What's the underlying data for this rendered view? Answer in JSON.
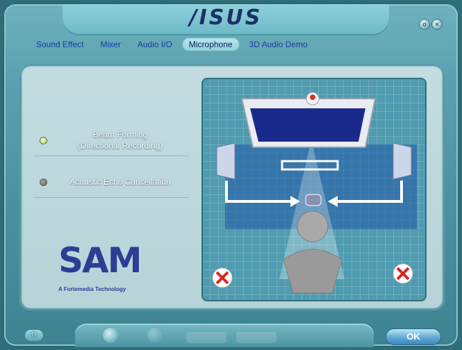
{
  "header": {
    "logo_text": "/ISUS",
    "minimize_glyph": "o",
    "close_glyph": "×"
  },
  "tabs": [
    {
      "label": "Sound Effect"
    },
    {
      "label": "Mixer"
    },
    {
      "label": "Audio I/O"
    },
    {
      "label": "Microphone",
      "active": true
    },
    {
      "label": "3D Audio Demo"
    }
  ],
  "options": [
    {
      "label_line1": "Beam Forming",
      "label_line2": "(Directional Recording)",
      "selected": true
    },
    {
      "label_line1": "Acoustic Echo Cancellation",
      "label_line2": "",
      "selected": false
    }
  ],
  "brand": {
    "logo_text": "SAM",
    "caption": "A Fortemedia Technology"
  },
  "footer": {
    "ok_label": "OK",
    "info_icon": "info-icon"
  },
  "colors": {
    "accent": "#2b3e93",
    "frame": "#5da2b0",
    "panel": "#c3dde1",
    "demo_bg": "#4f9bb0"
  }
}
